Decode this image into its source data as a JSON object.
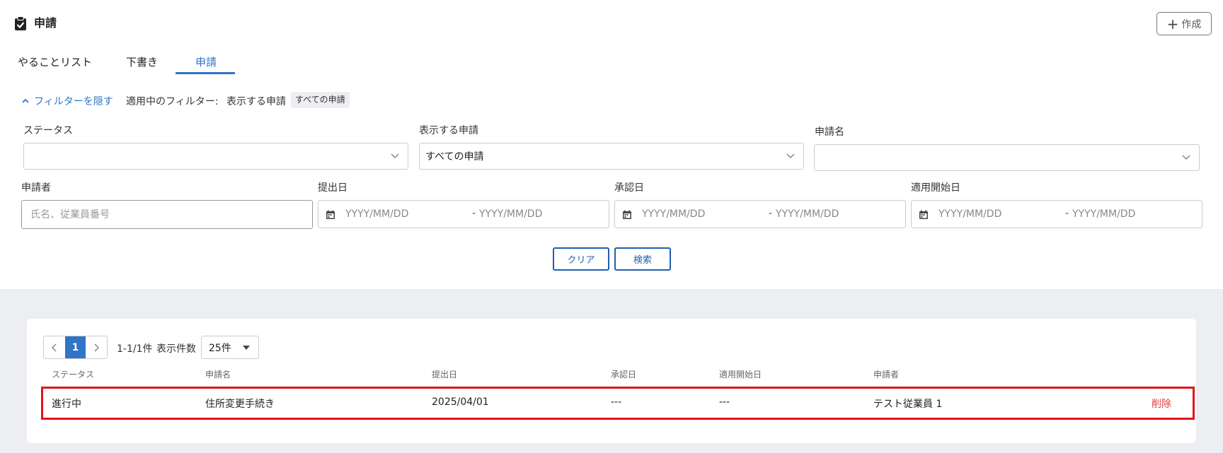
{
  "page": {
    "title": "申請",
    "icon": "clipboard-check-icon"
  },
  "header": {
    "create_label": "作成"
  },
  "tabs": [
    {
      "label": "やることリスト",
      "active": false
    },
    {
      "label": "下書き",
      "active": false
    },
    {
      "label": "申請",
      "active": true
    }
  ],
  "filter_bar": {
    "toggle_label": "フィルターを隠す",
    "active_label": "適用中のフィルター:",
    "active_field": "表示する申請",
    "active_chip": "すべての申請"
  },
  "filters": {
    "status": {
      "label": "ステータス",
      "value": ""
    },
    "display": {
      "label": "表示する申請",
      "value": "すべての申請"
    },
    "name": {
      "label": "申請名",
      "value": ""
    },
    "applicant": {
      "label": "申請者",
      "placeholder": "氏名、従業員番号",
      "value": ""
    },
    "submitted": {
      "label": "提出日",
      "from_placeholder": "YYYY/MM/DD",
      "to_placeholder": "YYYY/MM/DD",
      "separator": "-"
    },
    "approved": {
      "label": "承認日",
      "from_placeholder": "YYYY/MM/DD",
      "to_placeholder": "YYYY/MM/DD",
      "separator": "-"
    },
    "effective": {
      "label": "適用開始日",
      "from_placeholder": "YYYY/MM/DD",
      "to_placeholder": "YYYY/MM/DD",
      "separator": "-"
    }
  },
  "actions": {
    "clear_label": "クリア",
    "search_label": "検索"
  },
  "pagination": {
    "current_page": "1",
    "range_text": "1-1/1件",
    "per_page_label": "表示件数",
    "per_page_value": "25件"
  },
  "table": {
    "columns": [
      "ステータス",
      "申請名",
      "提出日",
      "承認日",
      "適用開始日",
      "申請者"
    ],
    "rows": [
      {
        "status": "進行中",
        "name": "住所変更手続き",
        "submitted": "2025/04/01",
        "approved": "---",
        "effective": "---",
        "applicant": "テスト従業員 1",
        "delete_label": "削除"
      }
    ]
  },
  "colors": {
    "accent": "#2f74c7",
    "highlight": "#e0141a",
    "danger": "#e0393e",
    "background": "#eceef2"
  }
}
